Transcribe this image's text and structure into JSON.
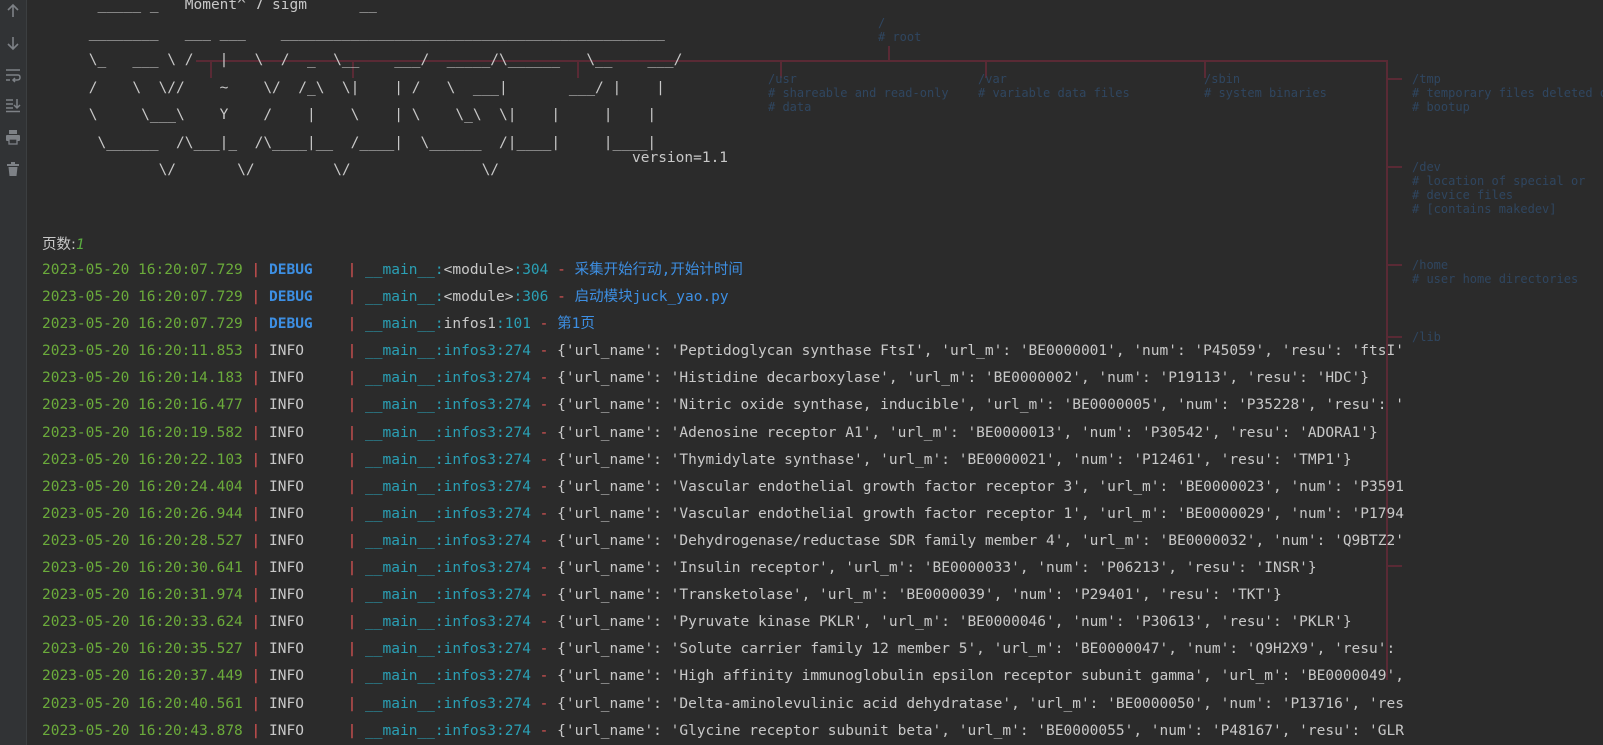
{
  "toolbar": {
    "icons": [
      "arrow-up-icon",
      "arrow-down-icon",
      "soft-wrap-icon",
      "scroll-to-end-icon",
      "print-icon",
      "trash-icon"
    ]
  },
  "banner": {
    "ascii": "  _____ _   Moment^ 7 sigm      __\n ________   ___ ___    ____________________________________________\n \\_   ___ \\ /   |   \\  /  _  \\__    ___/  _____/\\______   \\__    ___/\n /    \\  \\//    ~    \\/  /_\\  \\|    | /   \\  ___|       ___/ |    |\n \\     \\___\\    Y    /    |    \\    | \\    \\_\\  \\|    |     |    |\n  \\______  /\\___|_  /\\____|__  /____|  \\______  /|____|     |____|\n         \\/       \\/         \\/               \\/",
    "version": "version=1.1"
  },
  "pages": {
    "label": "页数:",
    "value": "1"
  },
  "log": [
    {
      "ts": "2023-05-20 16:20:07.729",
      "level": "DEBUG",
      "mod": "__main__",
      "fn": "<module>",
      "line": "304",
      "msg": "采集开始行动,开始计时间"
    },
    {
      "ts": "2023-05-20 16:20:07.729",
      "level": "DEBUG",
      "mod": "__main__",
      "fn": "<module>",
      "line": "306",
      "msg": "启动模块juck_yao.py"
    },
    {
      "ts": "2023-05-20 16:20:07.729",
      "level": "DEBUG",
      "mod": "__main__",
      "fn": "infos1",
      "line": "101",
      "msg": "第1页"
    },
    {
      "ts": "2023-05-20 16:20:11.853",
      "level": "INFO",
      "mod": "__main__",
      "fn": "infos3",
      "line": "274",
      "msg": "{'url_name': 'Peptidoglycan synthase FtsI', 'url_m': 'BE0000001', 'num': 'P45059', 'resu': 'ftsI'"
    },
    {
      "ts": "2023-05-20 16:20:14.183",
      "level": "INFO",
      "mod": "__main__",
      "fn": "infos3",
      "line": "274",
      "msg": "{'url_name': 'Histidine decarboxylase', 'url_m': 'BE0000002', 'num': 'P19113', 'resu': 'HDC'}"
    },
    {
      "ts": "2023-05-20 16:20:16.477",
      "level": "INFO",
      "mod": "__main__",
      "fn": "infos3",
      "line": "274",
      "msg": "{'url_name': 'Nitric oxide synthase, inducible', 'url_m': 'BE0000005', 'num': 'P35228', 'resu': '"
    },
    {
      "ts": "2023-05-20 16:20:19.582",
      "level": "INFO",
      "mod": "__main__",
      "fn": "infos3",
      "line": "274",
      "msg": "{'url_name': 'Adenosine receptor A1', 'url_m': 'BE0000013', 'num': 'P30542', 'resu': 'ADORA1'}"
    },
    {
      "ts": "2023-05-20 16:20:22.103",
      "level": "INFO",
      "mod": "__main__",
      "fn": "infos3",
      "line": "274",
      "msg": "{'url_name': 'Thymidylate synthase', 'url_m': 'BE0000021', 'num': 'P12461', 'resu': 'TMP1'}"
    },
    {
      "ts": "2023-05-20 16:20:24.404",
      "level": "INFO",
      "mod": "__main__",
      "fn": "infos3",
      "line": "274",
      "msg": "{'url_name': 'Vascular endothelial growth factor receptor 3', 'url_m': 'BE0000023', 'num': 'P3591"
    },
    {
      "ts": "2023-05-20 16:20:26.944",
      "level": "INFO",
      "mod": "__main__",
      "fn": "infos3",
      "line": "274",
      "msg": "{'url_name': 'Vascular endothelial growth factor receptor 1', 'url_m': 'BE0000029', 'num': 'P1794"
    },
    {
      "ts": "2023-05-20 16:20:28.527",
      "level": "INFO",
      "mod": "__main__",
      "fn": "infos3",
      "line": "274",
      "msg": "{'url_name': 'Dehydrogenase/reductase SDR family member 4', 'url_m': 'BE0000032', 'num': 'Q9BTZ2'"
    },
    {
      "ts": "2023-05-20 16:20:30.641",
      "level": "INFO",
      "mod": "__main__",
      "fn": "infos3",
      "line": "274",
      "msg": "{'url_name': 'Insulin receptor', 'url_m': 'BE0000033', 'num': 'P06213', 'resu': 'INSR'}"
    },
    {
      "ts": "2023-05-20 16:20:31.974",
      "level": "INFO",
      "mod": "__main__",
      "fn": "infos3",
      "line": "274",
      "msg": "{'url_name': 'Transketolase', 'url_m': 'BE0000039', 'num': 'P29401', 'resu': 'TKT'}"
    },
    {
      "ts": "2023-05-20 16:20:33.624",
      "level": "INFO",
      "mod": "__main__",
      "fn": "infos3",
      "line": "274",
      "msg": "{'url_name': 'Pyruvate kinase PKLR', 'url_m': 'BE0000046', 'num': 'P30613', 'resu': 'PKLR'}"
    },
    {
      "ts": "2023-05-20 16:20:35.527",
      "level": "INFO",
      "mod": "__main__",
      "fn": "infos3",
      "line": "274",
      "msg": "{'url_name': 'Solute carrier family 12 member 5', 'url_m': 'BE0000047', 'num': 'Q9H2X9', 'resu': "
    },
    {
      "ts": "2023-05-20 16:20:37.449",
      "level": "INFO",
      "mod": "__main__",
      "fn": "infos3",
      "line": "274",
      "msg": "{'url_name': 'High affinity immunoglobulin epsilon receptor subunit gamma', 'url_m': 'BE0000049', "
    },
    {
      "ts": "2023-05-20 16:20:40.561",
      "level": "INFO",
      "mod": "__main__",
      "fn": "infos3",
      "line": "274",
      "msg": "{'url_name': 'Delta-aminolevulinic acid dehydratase', 'url_m': 'BE0000050', 'num': 'P13716', 'res"
    },
    {
      "ts": "2023-05-20 16:20:43.878",
      "level": "INFO",
      "mod": "__main__",
      "fn": "infos3",
      "line": "274",
      "msg": "{'url_name': 'Glycine receptor subunit beta', 'url_m': 'BE0000055', 'num': 'P48167', 'resu': 'GLR"
    }
  ],
  "background_art": {
    "root": "/\n# root",
    "usr": "/usr\n# shareable and read-only\n# data",
    "var": "/var\n# variable data files",
    "sbin": "/sbin\n# system binaries",
    "tmp": "/tmp\n# temporary files deleted o\n# bootup",
    "dev": "/dev\n# location of special or\n# device files\n# [contains makedev]",
    "home": "/home\n# user home directories",
    "lib": "/lib"
  },
  "colors": {
    "background": "#2b2b2b",
    "timestamp": "#6bab3b",
    "separator": "#e05555",
    "debug": "#3d8fe3",
    "module": "#2aa0b5"
  }
}
